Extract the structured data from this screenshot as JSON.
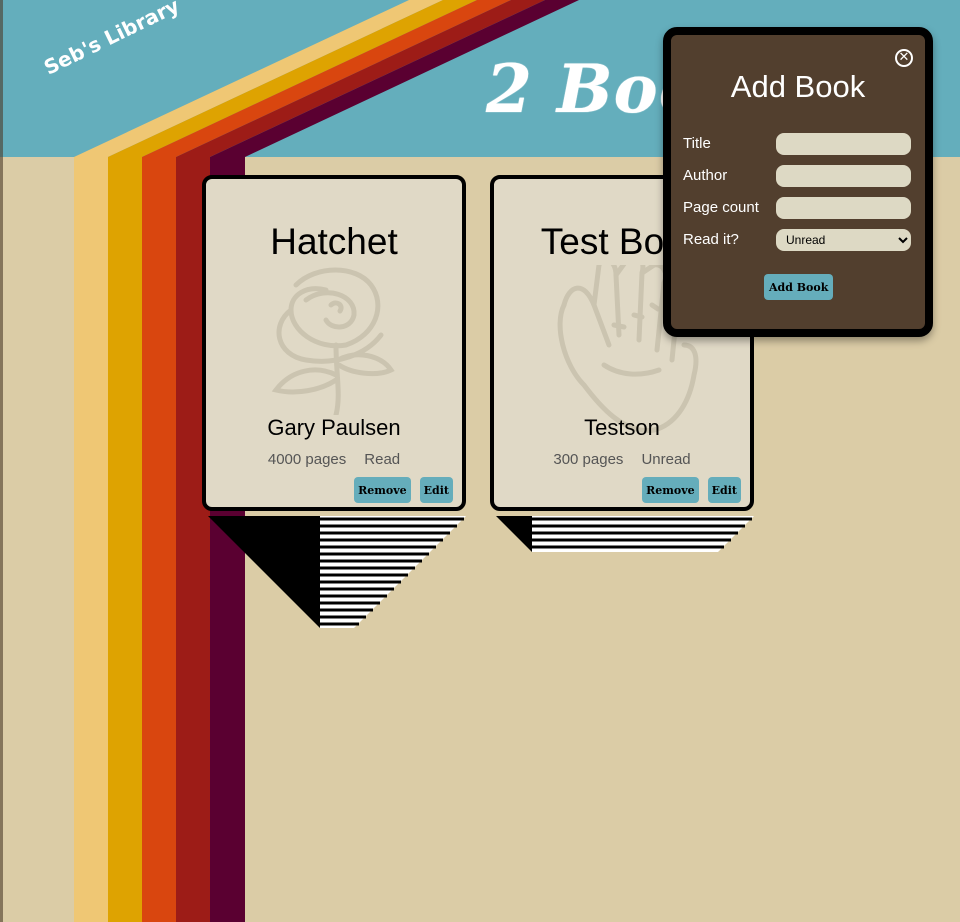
{
  "header": {
    "brand": "Seb's Library",
    "heading": "2 Books"
  },
  "books": [
    {
      "title": "Hatchet",
      "author": "Gary Paulsen",
      "pages": "4000 pages",
      "status": "Read",
      "art": "rose-icon",
      "remove_label": "Remove",
      "edit_label": "Edit"
    },
    {
      "title": "Test Book",
      "author": "Testson",
      "pages": "300 pages",
      "status": "Unread",
      "art": "hand-icon",
      "remove_label": "Remove",
      "edit_label": "Edit"
    }
  ],
  "modal": {
    "title": "Add Book",
    "close_icon": "close-icon",
    "fields": {
      "title_label": "Title",
      "title_value": "",
      "author_label": "Author",
      "author_value": "",
      "pagecount_label": "Page count",
      "pagecount_value": "",
      "read_label": "Read it?",
      "read_selected": "Unread"
    },
    "submit_label": "Add Book"
  },
  "colors": {
    "sky": "#64aebc",
    "sand": "#dbcca6",
    "stripes": [
      "#efc774",
      "#dea301",
      "#d9460f",
      "#9d1c17",
      "#5a0031"
    ],
    "card": "#e0d9c6",
    "button": "#65adbb",
    "modal": "#523f2e"
  }
}
